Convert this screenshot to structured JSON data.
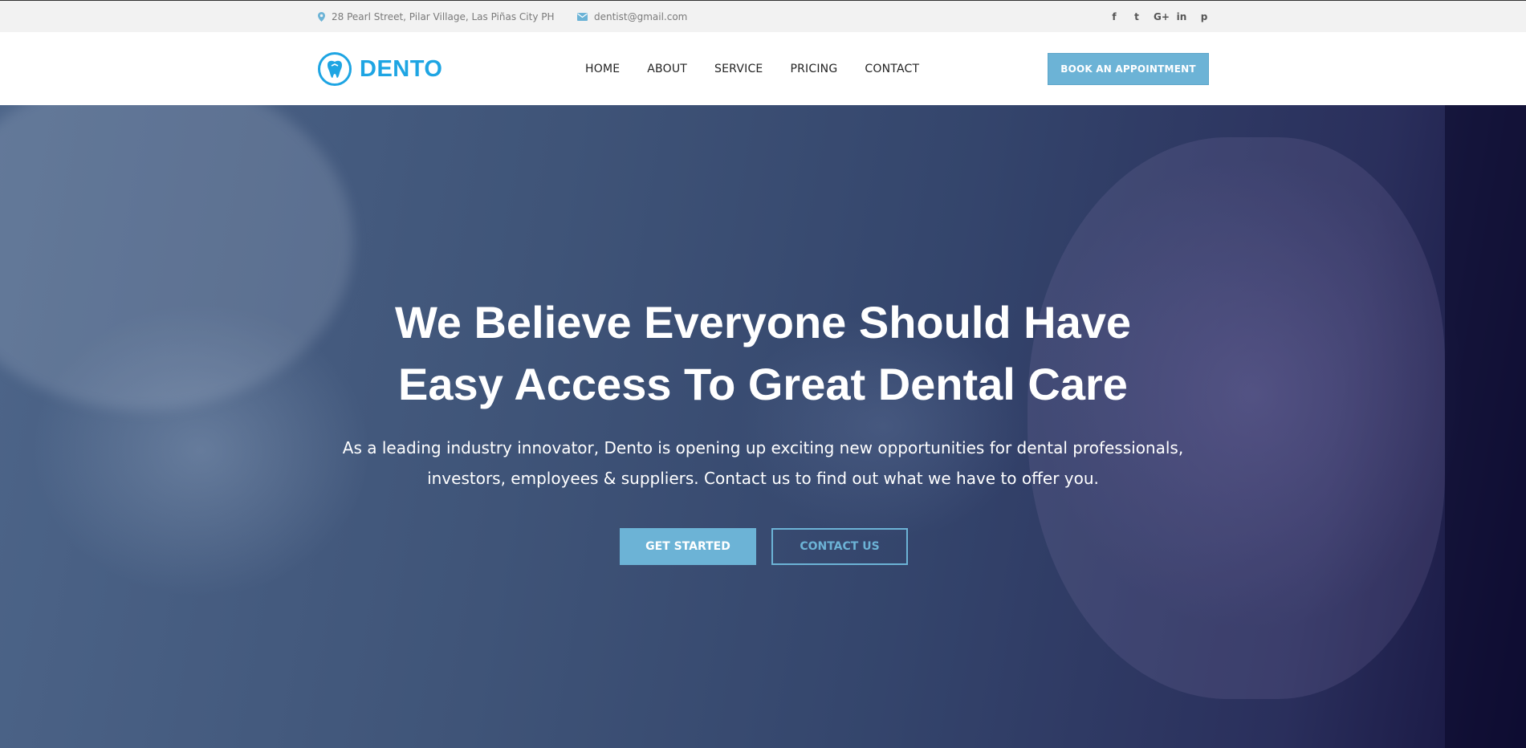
{
  "topbar": {
    "address": "28 Pearl Street, Pilar Village, Las Piñas City PH",
    "email": "dentist@gmail.com",
    "socials": [
      {
        "name": "facebook-icon",
        "glyph": "f"
      },
      {
        "name": "twitter-icon",
        "glyph": "t"
      },
      {
        "name": "google-plus-icon",
        "glyph": "G+"
      },
      {
        "name": "linkedin-icon",
        "glyph": "in"
      },
      {
        "name": "pinterest-icon",
        "glyph": "p"
      }
    ]
  },
  "header": {
    "logo_text": "DENTO",
    "nav": [
      "HOME",
      "ABOUT",
      "SERVICE",
      "PRICING",
      "CONTACT"
    ],
    "book_label": "BOOK AN APPOINTMENT"
  },
  "hero": {
    "headline_line1": "We Believe Everyone Should Have",
    "headline_line2": "Easy Access To Great Dental Care",
    "sub_line1": "As a leading industry innovator, Dento is opening up exciting new opportunities for dental professionals,",
    "sub_line2": "investors, employees & suppliers. Contact us to find out what we have to offer you.",
    "primary_label": "GET STARTED",
    "secondary_label": "CONTACT US"
  },
  "colors": {
    "brand": "#1ea5e3",
    "accent": "#6cb3d6",
    "topbar_bg": "#f2f2f2"
  }
}
